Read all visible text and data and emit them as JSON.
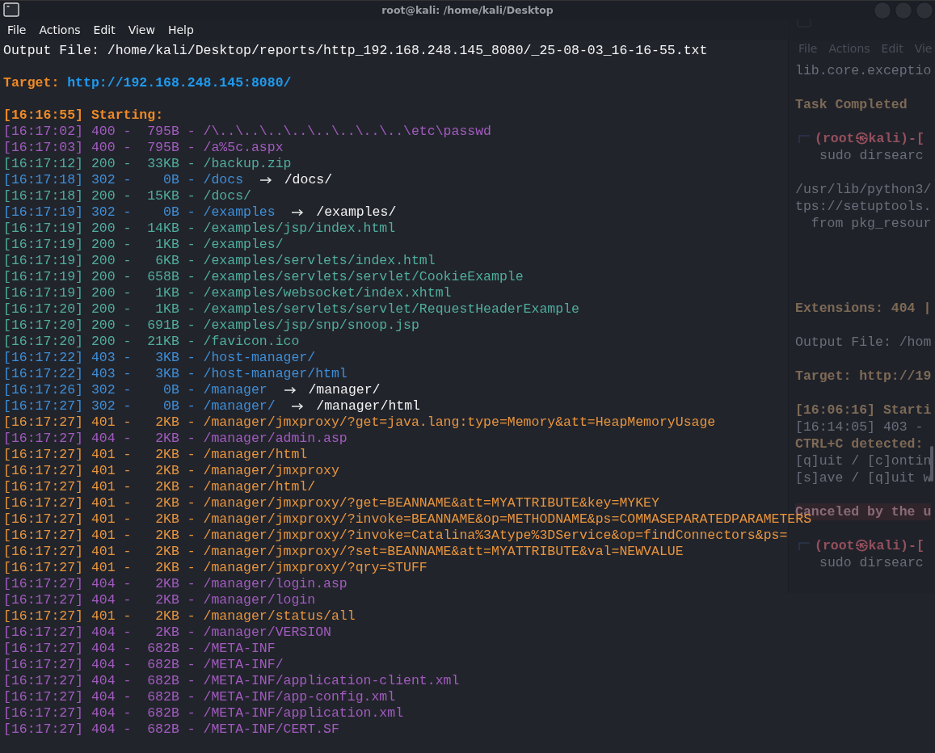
{
  "window": {
    "title": "root@kali: /home/kali/Desktop"
  },
  "menu": [
    "File",
    "Actions",
    "Edit",
    "View",
    "Help"
  ],
  "output_file": {
    "label": "Output File:",
    "value": "/home/kali/Desktop/reports/http_192.168.248.145_8080/_25-08-03_16-16-55.txt"
  },
  "target": {
    "label": "Target:",
    "value": "http://192.168.248.145:8080/"
  },
  "start": {
    "time": "[16:16:55]",
    "label": "Starting:"
  },
  "rows": [
    {
      "time": "[16:17:02]",
      "status": "400 -",
      "size": "795B -",
      "path": "/\\..\\..\\..\\..\\..\\..\\..\\..\\etc\\passwd",
      "color": "#a25bbf"
    },
    {
      "time": "[16:17:03]",
      "status": "400 -",
      "size": "795B -",
      "path": "/a%5c.aspx",
      "color": "#a25bbf"
    },
    {
      "time": "[16:17:12]",
      "status": "200 -",
      "size": "33KB -",
      "path": "/backup.zip",
      "color": "#4fae9c"
    },
    {
      "time": "[16:17:18]",
      "status": "302 -",
      "size": "0B -",
      "path": "/docs",
      "redirect": "/docs/",
      "color": "#3d8fd9"
    },
    {
      "time": "[16:17:18]",
      "status": "200 -",
      "size": "15KB -",
      "path": "/docs/",
      "color": "#4fae9c"
    },
    {
      "time": "[16:17:19]",
      "status": "302 -",
      "size": "0B -",
      "path": "/examples",
      "redirect": "/examples/",
      "color": "#3d8fd9"
    },
    {
      "time": "[16:17:19]",
      "status": "200 -",
      "size": "14KB -",
      "path": "/examples/jsp/index.html",
      "color": "#4fae9c"
    },
    {
      "time": "[16:17:19]",
      "status": "200 -",
      "size": "1KB -",
      "path": "/examples/",
      "color": "#4fae9c"
    },
    {
      "time": "[16:17:19]",
      "status": "200 -",
      "size": "6KB -",
      "path": "/examples/servlets/index.html",
      "color": "#4fae9c"
    },
    {
      "time": "[16:17:19]",
      "status": "200 -",
      "size": "658B -",
      "path": "/examples/servlets/servlet/CookieExample",
      "color": "#4fae9c"
    },
    {
      "time": "[16:17:19]",
      "status": "200 -",
      "size": "1KB -",
      "path": "/examples/websocket/index.xhtml",
      "color": "#4fae9c"
    },
    {
      "time": "[16:17:20]",
      "status": "200 -",
      "size": "1KB -",
      "path": "/examples/servlets/servlet/RequestHeaderExample",
      "color": "#4fae9c"
    },
    {
      "time": "[16:17:20]",
      "status": "200 -",
      "size": "691B -",
      "path": "/examples/jsp/snp/snoop.jsp",
      "color": "#4fae9c"
    },
    {
      "time": "[16:17:20]",
      "status": "200 -",
      "size": "21KB -",
      "path": "/favicon.ico",
      "color": "#4fae9c"
    },
    {
      "time": "[16:17:22]",
      "status": "403 -",
      "size": "3KB -",
      "path": "/host-manager/",
      "color": "#3d8fd9"
    },
    {
      "time": "[16:17:22]",
      "status": "403 -",
      "size": "3KB -",
      "path": "/host-manager/html",
      "color": "#3d8fd9"
    },
    {
      "time": "[16:17:26]",
      "status": "302 -",
      "size": "0B -",
      "path": "/manager",
      "redirect": "/manager/",
      "color": "#3d8fd9"
    },
    {
      "time": "[16:17:27]",
      "status": "302 -",
      "size": "0B -",
      "path": "/manager/",
      "redirect": "/manager/html",
      "color": "#3d8fd9"
    },
    {
      "time": "[16:17:27]",
      "status": "401 -",
      "size": "2KB -",
      "path": "/manager/jmxproxy/?get=java.lang:type=Memory&att=HeapMemoryUsage",
      "color": "#e8953c"
    },
    {
      "time": "[16:17:27]",
      "status": "404 -",
      "size": "2KB -",
      "path": "/manager/admin.asp",
      "color": "#a25bbf"
    },
    {
      "time": "[16:17:27]",
      "status": "401 -",
      "size": "2KB -",
      "path": "/manager/html",
      "color": "#e8953c"
    },
    {
      "time": "[16:17:27]",
      "status": "401 -",
      "size": "2KB -",
      "path": "/manager/jmxproxy",
      "color": "#e8953c"
    },
    {
      "time": "[16:17:27]",
      "status": "401 -",
      "size": "2KB -",
      "path": "/manager/html/",
      "color": "#e8953c"
    },
    {
      "time": "[16:17:27]",
      "status": "401 -",
      "size": "2KB -",
      "path": "/manager/jmxproxy/?get=BEANNAME&att=MYATTRIBUTE&key=MYKEY",
      "color": "#e8953c"
    },
    {
      "time": "[16:17:27]",
      "status": "401 -",
      "size": "2KB -",
      "path": "/manager/jmxproxy/?invoke=BEANNAME&op=METHODNAME&ps=COMMASEPARATEDPARAMETERS",
      "color": "#e8953c"
    },
    {
      "time": "[16:17:27]",
      "status": "401 -",
      "size": "2KB -",
      "path": "/manager/jmxproxy/?invoke=Catalina%3Atype%3DService&op=findConnectors&ps=",
      "color": "#e8953c"
    },
    {
      "time": "[16:17:27]",
      "status": "401 -",
      "size": "2KB -",
      "path": "/manager/jmxproxy/?set=BEANNAME&att=MYATTRIBUTE&val=NEWVALUE",
      "color": "#e8953c"
    },
    {
      "time": "[16:17:27]",
      "status": "401 -",
      "size": "2KB -",
      "path": "/manager/jmxproxy/?qry=STUFF",
      "color": "#e8953c"
    },
    {
      "time": "[16:17:27]",
      "status": "404 -",
      "size": "2KB -",
      "path": "/manager/login.asp",
      "color": "#a25bbf"
    },
    {
      "time": "[16:17:27]",
      "status": "404 -",
      "size": "2KB -",
      "path": "/manager/login",
      "color": "#a25bbf"
    },
    {
      "time": "[16:17:27]",
      "status": "401 -",
      "size": "2KB -",
      "path": "/manager/status/all",
      "color": "#e8953c"
    },
    {
      "time": "[16:17:27]",
      "status": "404 -",
      "size": "2KB -",
      "path": "/manager/VERSION",
      "color": "#a25bbf"
    },
    {
      "time": "[16:17:27]",
      "status": "404 -",
      "size": "682B -",
      "path": "/META-INF",
      "color": "#a25bbf"
    },
    {
      "time": "[16:17:27]",
      "status": "404 -",
      "size": "682B -",
      "path": "/META-INF/",
      "color": "#a25bbf"
    },
    {
      "time": "[16:17:27]",
      "status": "404 -",
      "size": "682B -",
      "path": "/META-INF/application-client.xml",
      "color": "#a25bbf"
    },
    {
      "time": "[16:17:27]",
      "status": "404 -",
      "size": "682B -",
      "path": "/META-INF/app-config.xml",
      "color": "#a25bbf"
    },
    {
      "time": "[16:17:27]",
      "status": "404 -",
      "size": "682B -",
      "path": "/META-INF/application.xml",
      "color": "#a25bbf"
    },
    {
      "time": "[16:17:27]",
      "status": "404 -",
      "size": "682B -",
      "path": "/META-INF/CERT.SF",
      "color": "#a25bbf"
    }
  ],
  "background_window": {
    "menu": [
      "File",
      "Actions",
      "Edit",
      "Vie"
    ],
    "lines": [
      {
        "kind": "plain",
        "text": "lib.core.exceptio"
      },
      {
        "kind": "blank"
      },
      {
        "kind": "heading",
        "text": "Task Completed"
      },
      {
        "kind": "blank"
      },
      {
        "kind": "prompt",
        "text": "(root㉿kali)-["
      },
      {
        "kind": "command",
        "text": "sudo dirsearc"
      },
      {
        "kind": "blank"
      },
      {
        "kind": "plain",
        "text": "/usr/lib/python3/"
      },
      {
        "kind": "plain",
        "text": "tps://setuptools."
      },
      {
        "kind": "plain",
        "text": "  from pkg_resour"
      },
      {
        "kind": "blank"
      },
      {
        "kind": "blank"
      },
      {
        "kind": "blank"
      },
      {
        "kind": "blank"
      },
      {
        "kind": "heading",
        "text": "Extensions: 404 |"
      },
      {
        "kind": "blank"
      },
      {
        "kind": "plain",
        "text": "Output File: /hom"
      },
      {
        "kind": "blank"
      },
      {
        "kind": "heading",
        "text": "Target: http://19"
      },
      {
        "kind": "blank"
      },
      {
        "kind": "heading",
        "text": "[16:06:16] Starti"
      },
      {
        "kind": "plain",
        "text": "[16:14:05] 403 -"
      },
      {
        "kind": "heading",
        "text": "CTRL+C detected:"
      },
      {
        "kind": "plain",
        "text": "[q]uit / [c]ontin"
      },
      {
        "kind": "plain",
        "text": "[s]ave / [q]uit w"
      },
      {
        "kind": "blank"
      },
      {
        "kind": "alert",
        "text": "Canceled by the u"
      },
      {
        "kind": "blank"
      },
      {
        "kind": "prompt",
        "text": "(root㉿kali)-["
      },
      {
        "kind": "command",
        "text": "sudo dirsearc"
      }
    ]
  }
}
